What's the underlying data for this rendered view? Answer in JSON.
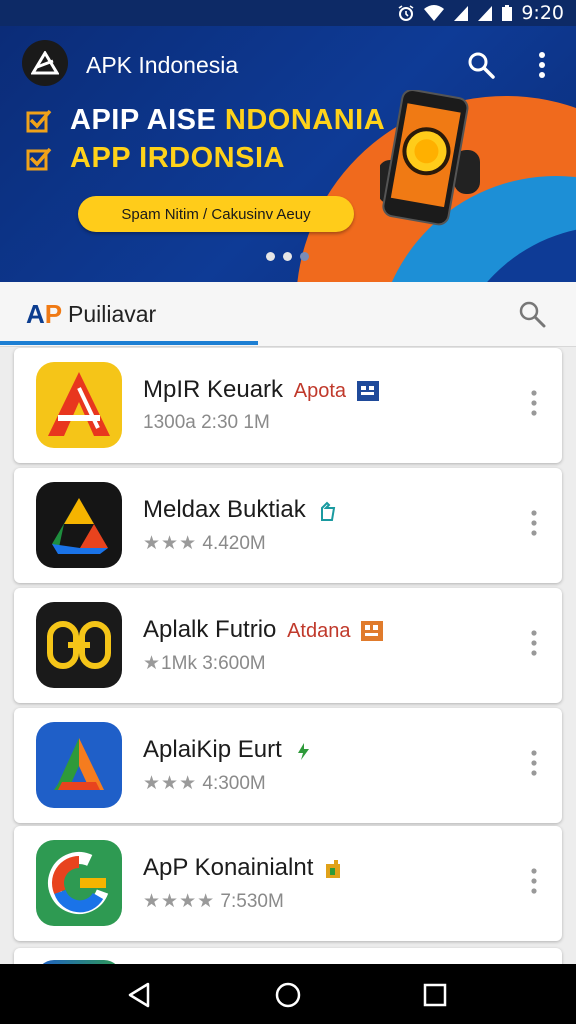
{
  "status_bar": {
    "time": "9:20",
    "icons": [
      "alarm-icon",
      "wifi-icon",
      "cell-signal-icon",
      "cell-signal-icon",
      "battery-icon"
    ]
  },
  "header": {
    "title": "APK Indonesia",
    "icons": [
      "app-logo-icon",
      "search-icon",
      "more-vert-icon"
    ]
  },
  "banner": {
    "line1_white": "APIP AISE ",
    "line1_yellow": "NDONANIA",
    "line2": "APP IRDONSIA",
    "cta_label": "Spam Nitim / Cakusinv Aeuy",
    "page_count": 3,
    "active_page": 1
  },
  "tab_bar": {
    "logo_a": "A",
    "logo_p": "P",
    "tab_label": "Puiliavar",
    "icons": [
      "search-icon"
    ]
  },
  "apps": [
    {
      "name": "MpIR Keuark",
      "tag": "Apota",
      "tag_color": "#c0392b",
      "badge_color": "#1f4a9a",
      "rating_stars": "",
      "meta": "1300a 2:30 1M",
      "icon": "red-a-app-icon"
    },
    {
      "name": "Meldax Buktiak",
      "tag": "",
      "tag_color": "#1a9aa0",
      "badge_color": "#1a9aa0",
      "rating_stars": "★★★",
      "meta": " 4.420M",
      "icon": "drive-triangle-app-icon"
    },
    {
      "name": "Aplalk Futrio",
      "tag": "Atdana",
      "tag_color": "#c0392b",
      "badge_color": "#e07b2c",
      "rating_stars": "★",
      "meta": "1Mk 3:600M",
      "icon": "yellow-knot-app-icon"
    },
    {
      "name": "AplaiKip Eurt",
      "tag": "",
      "tag_color": "#2e9a3a",
      "badge_color": "#2e9a3a",
      "rating_stars": "★★★",
      "meta": " 4:300M",
      "icon": "blue-a-app-icon"
    },
    {
      "name": "ApP Konainialnt",
      "tag": "",
      "tag_color": "#e0a21a",
      "badge_color": "#2e9a3a",
      "rating_stars": "★★★★",
      "meta": " 7:530M",
      "icon": "google-g-app-icon"
    }
  ],
  "nav_bar": {
    "icons": [
      "back-icon",
      "home-icon",
      "recents-icon"
    ]
  }
}
